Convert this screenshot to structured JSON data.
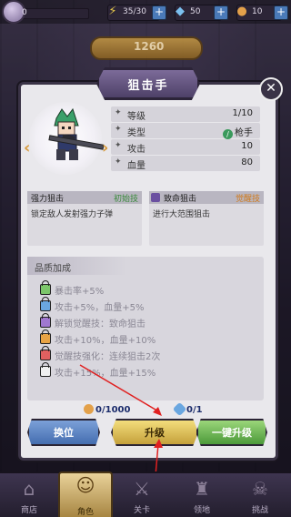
{
  "topbar": {
    "xp_value": "0",
    "stamina": "35/30",
    "gems": "50",
    "gold": "10"
  },
  "gold_badge": "1260",
  "title": "狙击手",
  "close_symbol": "✕",
  "hero": {
    "arrow_left": "‹",
    "arrow_right": "›"
  },
  "stats": [
    {
      "key": "等级",
      "value": "1/10"
    },
    {
      "key": "类型",
      "value": "枪手",
      "icon": "rifle-role-icon"
    },
    {
      "key": "攻击",
      "value": "10"
    },
    {
      "key": "血量",
      "value": "80"
    }
  ],
  "skills": {
    "left": {
      "name": "强力狙击",
      "tag": "初始技",
      "tag_color": "#3a8a3c",
      "desc": "锁定敌人发射强力子弹"
    },
    "right": {
      "name": "致命狙击",
      "tag": "觉醒技",
      "tag_color": "#d07a1c",
      "desc": "进行大范围狙击"
    }
  },
  "quality": {
    "title": "品质加成",
    "items": [
      {
        "text": "暴击率+5%",
        "lock_color": "#7cc66a"
      },
      {
        "text": "攻击+5%，血量+5%",
        "lock_color": "#6aa7e0"
      },
      {
        "text": "解锁觉醒技：致命狙击",
        "lock_color": "#a078d0"
      },
      {
        "text": "攻击+10%，血量+10%",
        "lock_color": "#e8a445"
      },
      {
        "text": "觉醒技强化：连续狙击2次",
        "lock_color": "#e06060"
      },
      {
        "text": "攻击+15%，血量+15%",
        "lock_color": "#f0f0f0"
      }
    ]
  },
  "costs": {
    "gold": "0/1000",
    "shard": "0/1"
  },
  "buttons": {
    "swap": "换位",
    "upgrade": "升级",
    "one_click": "一键升级"
  },
  "nav": [
    {
      "label": "商店",
      "icon": "shop-icon"
    },
    {
      "label": "角色",
      "icon": "character-icon"
    },
    {
      "label": "关卡",
      "icon": "level-icon"
    },
    {
      "label": "领地",
      "icon": "territory-icon"
    },
    {
      "label": "挑战",
      "icon": "challenge-icon"
    }
  ]
}
